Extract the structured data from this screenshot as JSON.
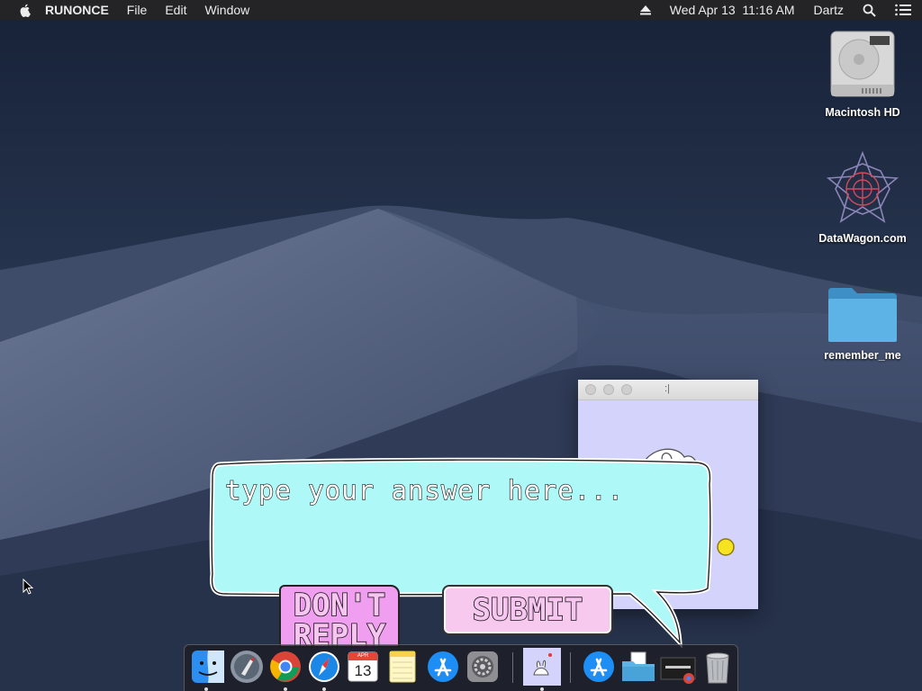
{
  "menubar": {
    "apple_icon": "apple-icon",
    "app_name": "RUNONCE",
    "menus": [
      "File",
      "Edit",
      "Window"
    ],
    "datetime": "Wed Apr 13  11:16 AM",
    "user": "Dartz",
    "status_icons": [
      "eject-icon",
      "search-icon",
      "list-icon"
    ]
  },
  "desktop_icons": [
    {
      "label": "Macintosh HD",
      "icon": "hard-drive-icon"
    },
    {
      "label": "DataWagon.com",
      "icon": "star-logo-icon"
    },
    {
      "label": "remember_me",
      "icon": "folder-icon"
    }
  ],
  "window": {
    "title": ":|",
    "background": "#d4d3fb"
  },
  "dialog": {
    "input_placeholder": "type your answer here...",
    "dont_reply_label": "DON'T REPLY",
    "submit_label": "SUBMIT",
    "bubble_color": "#aff8f8",
    "dont_reply_color": "#f09ef0",
    "submit_color": "#f7c9ef"
  },
  "dock": {
    "items": [
      {
        "name": "finder-icon",
        "running": true
      },
      {
        "name": "launchpad-icon",
        "running": false
      },
      {
        "name": "chrome-icon",
        "running": true
      },
      {
        "name": "safari-icon",
        "running": true
      },
      {
        "name": "calendar-icon",
        "running": false,
        "month": "APR",
        "day": "13"
      },
      {
        "name": "notes-icon",
        "running": false
      },
      {
        "name": "app-store-icon",
        "running": false
      },
      {
        "name": "system-preferences-icon",
        "running": false
      },
      {
        "name": "runonce-app-icon",
        "running": true
      },
      {
        "name": "applications-folder-icon",
        "running": false
      },
      {
        "name": "documents-folder-icon",
        "running": false
      },
      {
        "name": "chrome-window-icon",
        "running": false
      },
      {
        "name": "trash-icon",
        "running": false
      }
    ]
  }
}
